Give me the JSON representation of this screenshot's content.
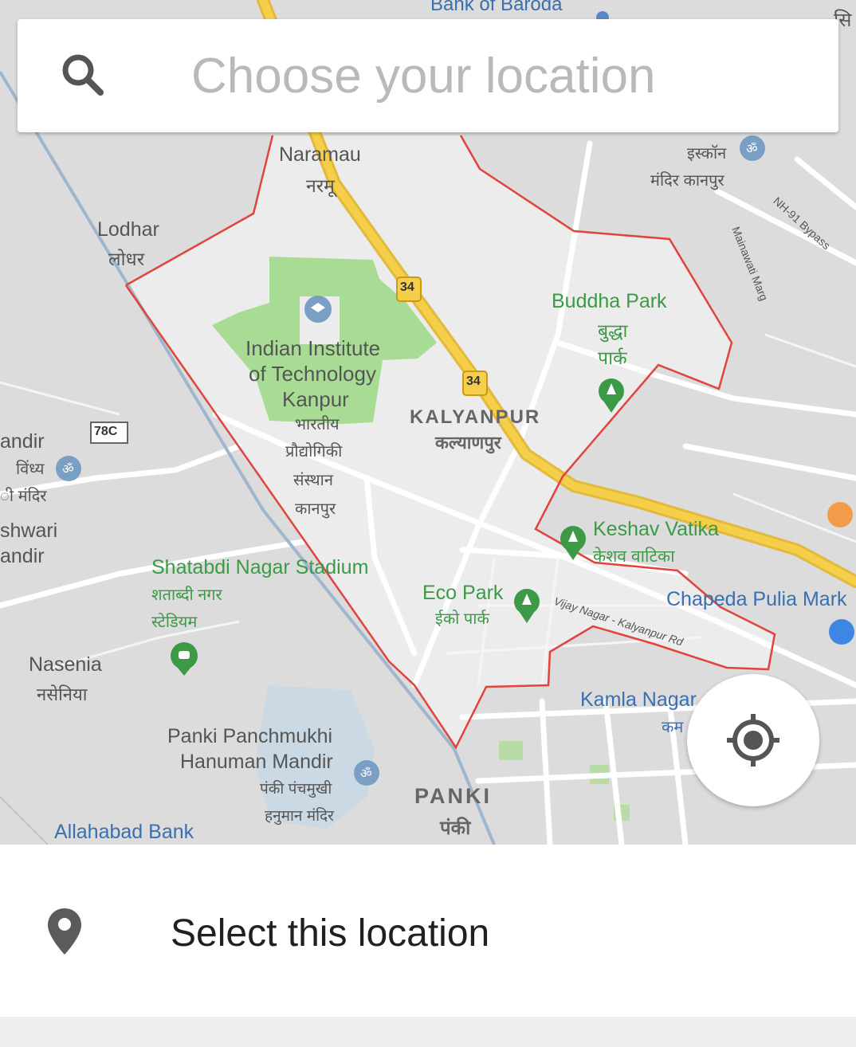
{
  "search": {
    "placeholder": "Choose your location",
    "icon": "search-icon"
  },
  "map": {
    "labels": {
      "bank_of_baroda": "Bank of Baroda",
      "naramau": "Naramau",
      "naramau_hi": "नरमू",
      "lodhar": "Lodhar",
      "lodhar_hi": "लोधर",
      "iskcon_hi_1": "इस्कॉन",
      "iskcon_hi_2": "मंदिर कानपुर",
      "nh91": "NH-91 Bypass",
      "mainawati": "Mainawati Marg",
      "buddha_park": "Buddha Park",
      "buddha_park_hi_1": "बुद्धा",
      "buddha_park_hi_2": "पार्क",
      "iit_1": "Indian Institute",
      "iit_2": "of Technology",
      "iit_3": "Kanpur",
      "iit_hi_1": "भारतीय",
      "iit_hi_2": "प्रौद्योगिकी",
      "iit_hi_3": "संस्थान",
      "iit_hi_4": "कानपुर",
      "kalyanpur": "KALYANPUR",
      "kalyanpur_hi": "कल्याणपुर",
      "route_34": "34",
      "route_78c": "78C",
      "mandir_1": "andir",
      "mandir_2": "विंध्य",
      "mandir_3": "ी मंदिर",
      "shwari": "shwari",
      "andir2": "andir",
      "keshav": "Keshav Vatika",
      "keshav_hi": "केशव वाटिका",
      "shatabdi": "Shatabdi Nagar Stadium",
      "shatabdi_hi_1": "शताब्दी नगर",
      "shatabdi_hi_2": "स्टेडियम",
      "eco_park": "Eco Park",
      "eco_park_hi": "ईको पार्क",
      "vijay_road": "Vijay Nagar - Kalyanpur Rd",
      "chapeda": "Chapeda Pulia Mark",
      "nasenia": "Nasenia",
      "nasenia_hi": "नसेनिया",
      "kamla_nagar": "Kamla Nagar",
      "kamla_nagar_hi": "कम",
      "panki_temple_1": "Panki Panchmukhi",
      "panki_temple_2": "Hanuman Mandir",
      "panki_temple_hi_1": "पंकी पंचमुखी",
      "panki_temple_hi_2": "हनुमान मंदिर",
      "panki": "PANKI",
      "panki_hi": "पंकी",
      "allahabad_bank": "Allahabad Bank",
      "corner_hi": "सि"
    }
  },
  "locate_button": {
    "icon": "my-location-icon"
  },
  "action": {
    "label": "Select this location",
    "icon": "location-pin-icon"
  },
  "colors": {
    "map_bg": "#e4e4e4",
    "boundary": "#e0443c",
    "highway": "#f6cf4a",
    "park": "#a8dc95"
  }
}
